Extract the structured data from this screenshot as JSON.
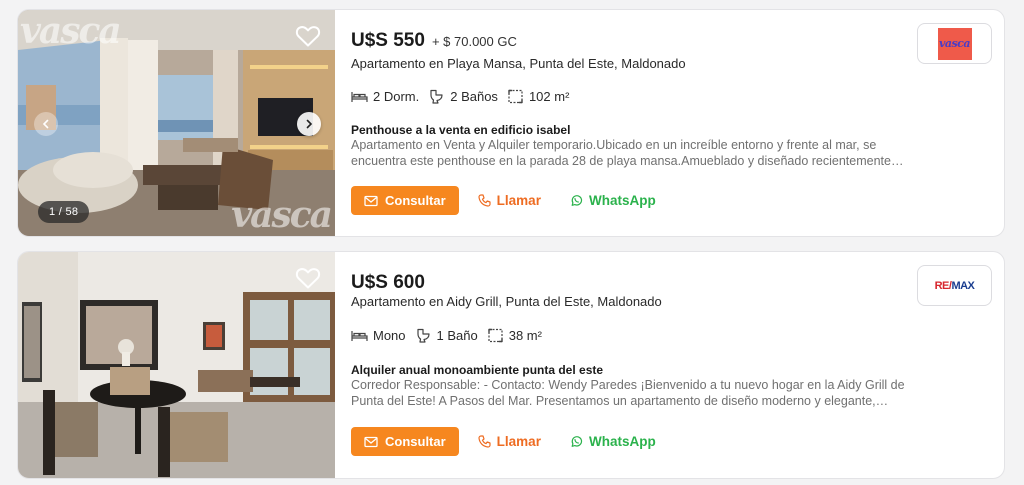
{
  "listings": [
    {
      "price": "U$S 550",
      "expenses": "+ $ 70.000 GC",
      "address": "Apartamento en Playa Mansa, Punta del Este, Maldonado",
      "features": {
        "rooms": "2 Dorm.",
        "baths": "2 Baños",
        "area": "102 m²"
      },
      "headline": "Penthouse a la venta en edificio isabel",
      "description": "Apartamento en Venta y Alquiler temporario.Ubicado en un increíble entorno y frente al mar, se encuentra este penthouse en la parada 28 de playa mansa.Amueblado y diseñado recientemente…",
      "photo_counter": "1 / 58",
      "watermark": "vasca",
      "agency_logo_text": "vasca",
      "icons": {
        "favorite": "heart-outline-icon",
        "prev": "chevron-left-icon",
        "next": "chevron-right-icon",
        "rooms": "bed-icon",
        "baths": "toilet-icon",
        "area": "area-icon"
      }
    },
    {
      "price": "U$S 600",
      "expenses": "",
      "address": "Apartamento en Aidy Grill, Punta del Este, Maldonado",
      "features": {
        "rooms": "Mono",
        "baths": "1 Baño",
        "area": "38 m²"
      },
      "headline": "Alquiler anual monoambiente punta del este",
      "description": "Corredor Responsable: - Contacto: Wendy Paredes ¡Bienvenido a tu nuevo hogar en la Aidy Grill de Punta del Este! A Pasos del Mar. Presentamos un apartamento de diseño moderno y elegante,…",
      "agency_logo_text": {
        "part1": "RE/",
        "part2": "MAX"
      },
      "icons": {
        "favorite": "heart-outline-icon",
        "rooms": "bed-icon",
        "baths": "toilet-icon",
        "area": "area-icon"
      }
    }
  ],
  "actions": {
    "consult_label": "Consultar",
    "call_label": "Llamar",
    "whatsapp_label": "WhatsApp",
    "icons": {
      "consult": "mail-icon",
      "call": "phone-icon",
      "whatsapp": "whatsapp-icon"
    }
  },
  "colors": {
    "accent": "#f6871f",
    "call_text": "#ee6c22",
    "whatsapp": "#2bb24c",
    "card_bg": "#ffffff",
    "page_bg": "#f3f3f4",
    "description_text": "#707070"
  }
}
